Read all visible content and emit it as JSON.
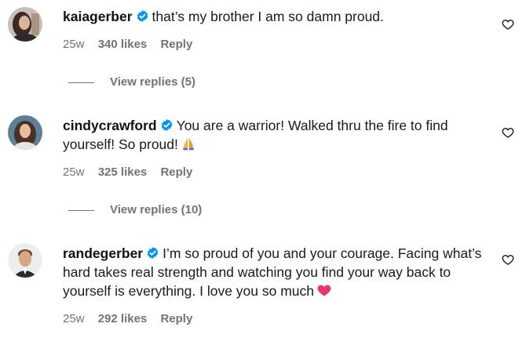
{
  "comments": [
    {
      "username": "kaiagerber",
      "text": "that’s my brother I am so damn proud.",
      "time": "25w",
      "likes": "340 likes",
      "reply": "Reply",
      "view_replies": "View replies (5)",
      "avatar_icon": "avatar-kaiagerber-icon"
    },
    {
      "username": "cindycrawford",
      "text": "You are a warrior! Walked thru the fire to find yourself! So proud!",
      "emoji": "folded-hands-emoji",
      "time": "25w",
      "likes": "325 likes",
      "reply": "Reply",
      "view_replies": "View replies (10)",
      "avatar_icon": "avatar-cindycrawford-icon"
    },
    {
      "username": "randegerber",
      "text": "I’m so proud of you and your courage. Facing what’s hard takes real strength and watching you find your way back to yourself is everything. I love you so much",
      "emoji": "pink-heart-emoji",
      "time": "25w",
      "likes": "292 likes",
      "reply": "Reply",
      "avatar_icon": "avatar-randegerber-icon"
    }
  ],
  "colors": {
    "verified_blue": "#0095f6",
    "secondary_text": "#737373",
    "heart_emoji": "#e8356d"
  },
  "icons": {
    "verified": "verified-badge-icon",
    "like": "heart-outline-icon"
  }
}
